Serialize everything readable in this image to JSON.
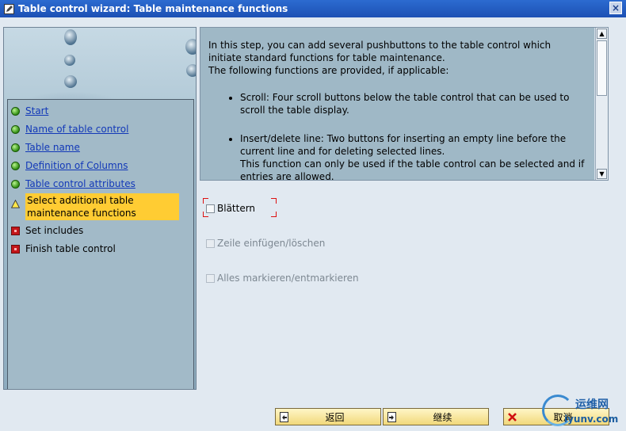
{
  "window": {
    "title": "Table control wizard: Table maintenance functions",
    "close_label": "×"
  },
  "nav": {
    "items": [
      {
        "label": "Start",
        "status": "done"
      },
      {
        "label": "Name of table control",
        "status": "done"
      },
      {
        "label": "Table name",
        "status": "done"
      },
      {
        "label": "Definition of Columns",
        "status": "done"
      },
      {
        "label": "Table control attributes",
        "status": "done"
      },
      {
        "label": "Select additional table maintenance functions",
        "status": "current"
      },
      {
        "label": "Set includes",
        "status": "pending"
      },
      {
        "label": "Finish table control",
        "status": "pending"
      }
    ]
  },
  "info": {
    "intro": "In this step, you can add several pushbuttons to the table control which initiate standard functions for table maintenance.",
    "intro2": "The following functions are provided, if applicable:",
    "bullets": [
      "Scroll: Four scroll buttons below the table control that can be used to scroll the table display.",
      "Insert/delete line: Two buttons for inserting an empty line before the current line and for deleting selected lines.",
      "This function can only be used if the table control can be selected and if entries are allowed."
    ]
  },
  "options": [
    {
      "label": "Blättern",
      "checked": false,
      "enabled": true
    },
    {
      "label": "Zeile einfügen/löschen",
      "checked": false,
      "enabled": false
    },
    {
      "label": "Alles markieren/entmarkieren",
      "checked": false,
      "enabled": false
    }
  ],
  "buttons": {
    "back": "返回",
    "continue": "继续",
    "cancel": "取消"
  },
  "watermark": {
    "name": "运维网",
    "url": "iyunv.com"
  }
}
